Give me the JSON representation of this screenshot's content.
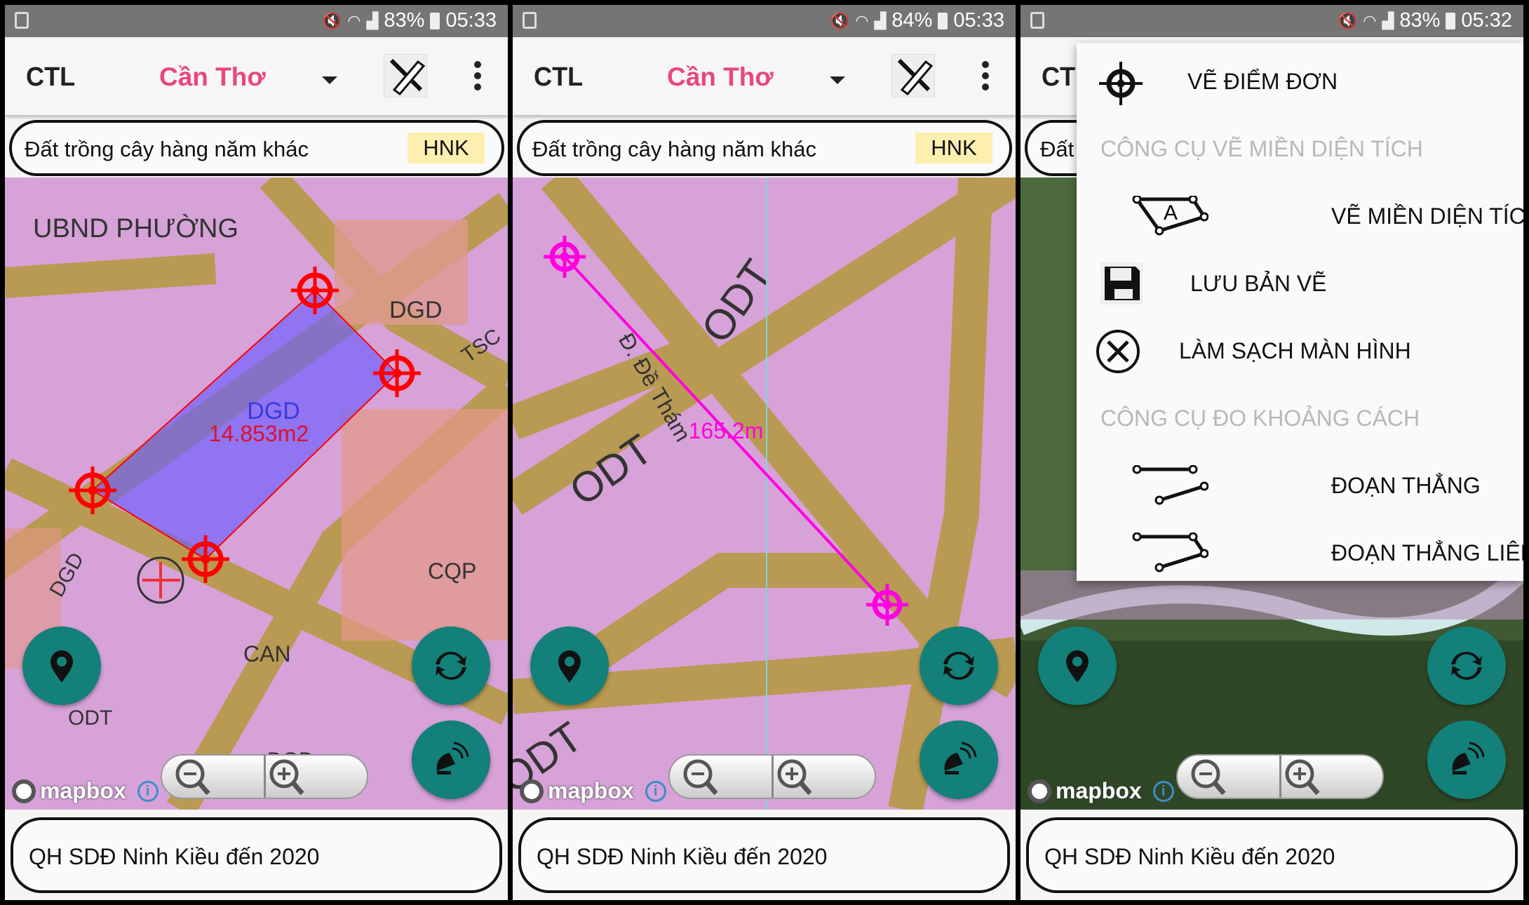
{
  "panels": [
    {
      "status": {
        "battery": "83%",
        "time": "05:33"
      },
      "toolbar": {
        "app_title": "CTL",
        "city": "Cần Thơ"
      },
      "search": {
        "text": "Đất trồng cây hàng năm khác",
        "code": "HNK"
      },
      "map": {
        "mode": "area",
        "labels": [
          "UBND PHƯỜNG",
          "DGD",
          "TSC",
          "DGD",
          "CQP",
          "CAN",
          "ODT",
          "DGD"
        ],
        "shape_label": "DGD",
        "measurement": "14.853m2",
        "accent": "#ff0000",
        "fill": "#6a5cff"
      },
      "attribution": "mapbox",
      "bottom": {
        "text": "QH SDĐ Ninh Kiều đến 2020"
      }
    },
    {
      "status": {
        "battery": "84%",
        "time": "05:33"
      },
      "toolbar": {
        "app_title": "CTL",
        "city": "Cần Thơ"
      },
      "search": {
        "text": "Đất trồng cây hàng năm khác",
        "code": "HNK"
      },
      "map": {
        "mode": "distance",
        "labels": [
          "ODT",
          "ODT",
          "Đ. Đề Thám",
          "ODT"
        ],
        "measurement": "165.2m",
        "accent": "#ff00e0"
      },
      "attribution": "mapbox",
      "bottom": {
        "text": "QH SDĐ Ninh Kiều đến 2020"
      }
    },
    {
      "status": {
        "battery": "83%",
        "time": "05:32"
      },
      "toolbar": {
        "app_title": "CTL",
        "city": "Cần Thơ"
      },
      "search": {
        "text": "Đất trồng cây hàng năm khác",
        "code": "HNK"
      },
      "map": {
        "mode": "satellite",
        "labels": []
      },
      "attribution": "mapbox",
      "bottom": {
        "text": "QH SDĐ Ninh Kiều đến 2020"
      },
      "menu": {
        "items": [
          {
            "type": "item",
            "icon": "crosshair-icon",
            "label": "VẼ ĐIỂM ĐƠN"
          },
          {
            "type": "header",
            "label": "CÔNG CỤ VẼ MIỀN DIỆN TÍCH"
          },
          {
            "type": "item",
            "icon": "polygon-area-icon",
            "label": "VẼ MIỀN DIỆN TÍCH"
          },
          {
            "type": "item",
            "icon": "floppy-save-icon",
            "label": "LƯU BẢN VẼ"
          },
          {
            "type": "item",
            "icon": "clear-circle-x-icon",
            "label": "LÀM SẠCH MÀN HÌNH"
          },
          {
            "type": "header",
            "label": "CÔNG CỤ ĐO KHOẢNG CÁCH"
          },
          {
            "type": "item",
            "icon": "line-segment-icon",
            "label": "ĐOẠN THẲNG"
          },
          {
            "type": "item",
            "icon": "polyline-icon",
            "label": "ĐOẠN THẲNG LIÊN T.."
          }
        ]
      }
    }
  ],
  "colors": {
    "fab": "#13807a",
    "city": "#e9477c",
    "badge": "#fcefb0",
    "status_bar": "#757575"
  }
}
